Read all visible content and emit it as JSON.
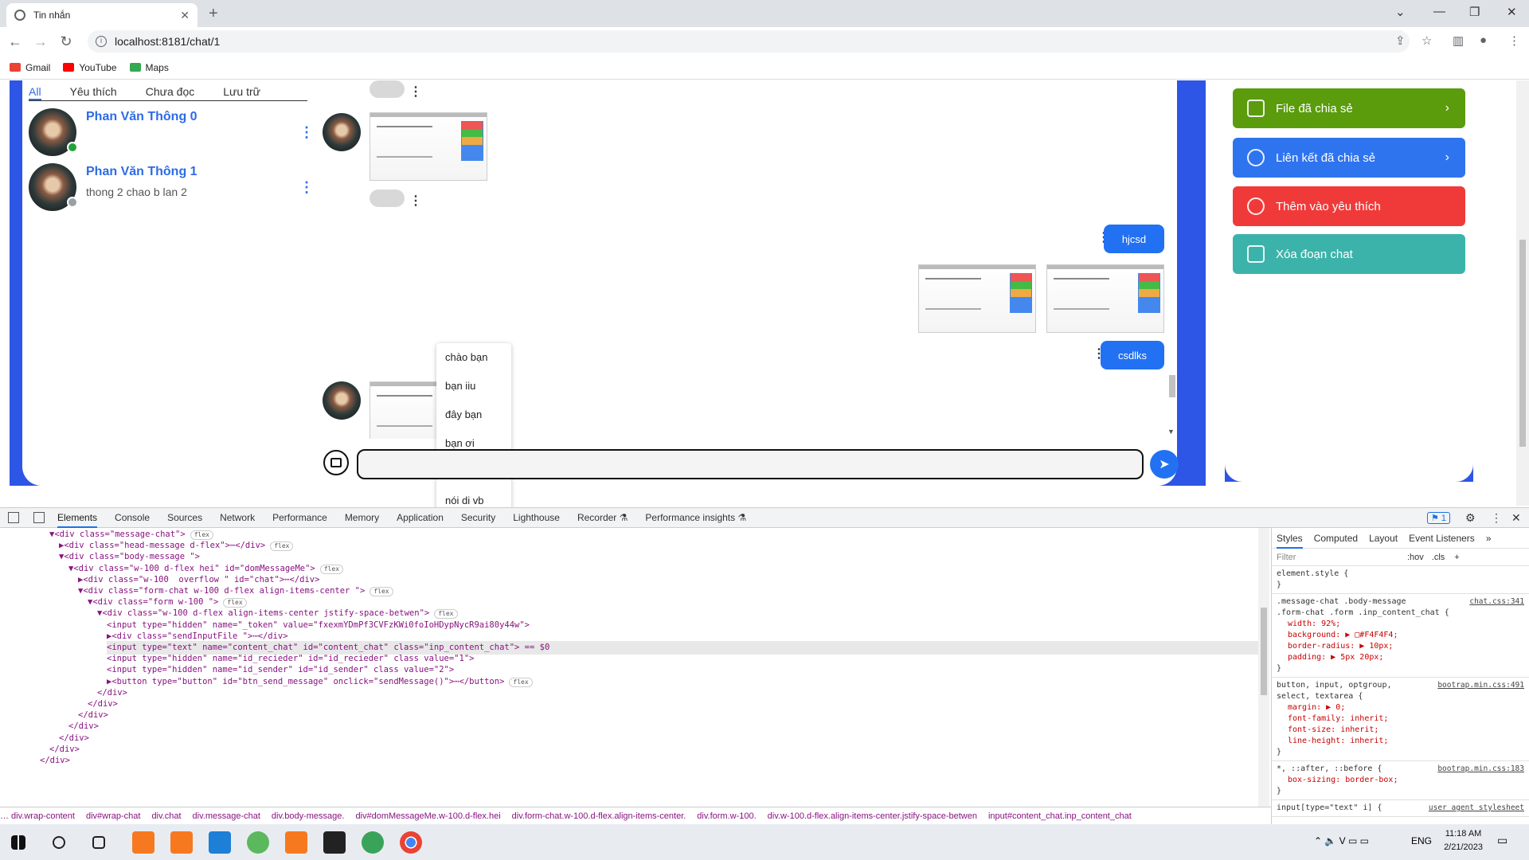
{
  "browser": {
    "tab_title": "Tin nhắn",
    "url": "localhost:8181/chat/1",
    "bookmarks": [
      "Gmail",
      "YouTube",
      "Maps"
    ]
  },
  "chat_list": {
    "filters": [
      "All",
      "Yêu thích",
      "Chưa đọc",
      "Lưu trữ"
    ],
    "contacts": [
      {
        "name": "Phan Văn Thông 0",
        "last_message": "",
        "status_color": "#22a33a"
      },
      {
        "name": "Phan Văn Thông 1",
        "last_message": "thong 2 chao b lan 2",
        "status_color": "#9aa0a6"
      }
    ]
  },
  "messages": {
    "sent_1": "hjcsd",
    "sent_2": "csdlks"
  },
  "quick_replies": [
    "chào bạn",
    "bạn iiu",
    "đây bạn",
    " bạn ơi",
    "bạn ơi",
    "nói di vb"
  ],
  "composer": {
    "value": "",
    "send_icon": "paper-plane-icon",
    "image_icon": "image-icon"
  },
  "actions": [
    {
      "label": "File đã chia sẻ",
      "color": "#5a9c0c",
      "icon": "file-icon"
    },
    {
      "label": "Liên kết đã chia sẻ",
      "color": "#2f74ef",
      "icon": "link-icon"
    },
    {
      "label": "Thêm vào yêu thích",
      "color": "#f03a3a",
      "icon": "heart-icon"
    },
    {
      "label": "Xóa đoạn chat",
      "color": "#3cb3aa",
      "icon": "trash-icon"
    }
  ],
  "footer": "footer",
  "devtools": {
    "tabs": [
      "Elements",
      "Console",
      "Sources",
      "Network",
      "Performance",
      "Memory",
      "Application",
      "Security",
      "Lighthouse",
      "Recorder ⚗",
      "Performance insights ⚗"
    ],
    "issues_count": "1",
    "style_tabs": [
      "Styles",
      "Computed",
      "Layout",
      "Event Listeners",
      "»"
    ],
    "filter_placeholder": "Filter",
    "filter_hov": ":hov",
    "filter_cls": ".cls",
    "dom_lines": [
      "▼<div class=\"message-chat\">",
      "▶<div class=\"head-message d-flex\">⋯</div>",
      "▼<div class=\"body-message \">",
      "▼<div class=\"w-100 d-flex hei\" id=\"domMessageMe\">",
      "▶<div class=\"w-100  overflow \" id=\"chat\">⋯</div>",
      "▼<div class=\"form-chat w-100 d-flex align-items-center \">",
      "▼<div class=\"form w-100 \">",
      "▼<div class=\"w-100 d-flex align-items-center jstify-space-betwen\">",
      "<input type=\"hidden\" name=\"_token\" value=\"fxexmYDmPf3CVFzKWi0foIoHDypNycR9ai80y44w\">",
      "▶<div class=\"sendInputFile \">⋯</div>",
      "<input type=\"text\" name=\"content_chat\" id=\"content_chat\" class=\"inp_content_chat\"> == $0",
      "<input type=\"hidden\" name=\"id_recieder\" id=\"id_recieder\" class value=\"1\">",
      "<input type=\"hidden\" name=\"id_sender\" id=\"id_sender\" class value=\"2\">",
      "▶<button type=\"button\" id=\"btn_send_message\" onclick=\"sendMessage()\">⋯</button>",
      "</div>",
      "</div>",
      "</div>",
      "</div>",
      "</div>",
      "</div>",
      "</div>"
    ],
    "dom_indents": [
      4,
      5,
      5,
      6,
      7,
      7,
      8,
      9,
      10,
      10,
      10,
      10,
      10,
      10,
      9,
      8,
      7,
      6,
      5,
      4,
      3
    ],
    "dom_badges": [
      true,
      true,
      false,
      true,
      false,
      true,
      true,
      true,
      false,
      false,
      false,
      false,
      false,
      true,
      false,
      false,
      false,
      false,
      false,
      false,
      false
    ],
    "styles": [
      {
        "selector": "element.style {",
        "source": "",
        "props": [],
        "close": "}"
      },
      {
        "selector": ".message-chat .body-message\n.form-chat .form .inp_content_chat {",
        "source": "chat.css:341",
        "props": [
          "width: 92%;",
          "background: ▶ □#F4F4F4;",
          "border-radius: ▶ 10px;",
          "padding: ▶ 5px 20px;"
        ],
        "close": "}"
      },
      {
        "selector": "button, input, optgroup,\nselect, textarea {",
        "source": "bootrap.min.css:491",
        "props": [
          "margin: ▶ 0;",
          "font-family: inherit;",
          "font-size: inherit;",
          "line-height: inherit;"
        ],
        "close": "}"
      },
      {
        "selector": "*, ::after, ::before {",
        "source": "bootrap.min.css:183",
        "props": [
          "box-sizing: border-box;"
        ],
        "close": "}"
      },
      {
        "selector": "input[type=\"text\" i] {",
        "source": "user agent stylesheet",
        "props": [],
        "close": ""
      }
    ],
    "breadcrumbs": [
      "…  div.wrap-content",
      "div#wrap-chat",
      "div.chat",
      "div.message-chat",
      "div.body-message.",
      "div#domMessageMe.w-100.d-flex.hei",
      "div.form-chat.w-100.d-flex.align-items-center.",
      "div.form.w-100.",
      "div.w-100.d-flex.align-items-center.jstify-space-betwen",
      "input#content_chat.inp_content_chat"
    ]
  },
  "taskbar": {
    "language": "ENG",
    "time": "11:18 AM",
    "date": "2/21/2023"
  }
}
